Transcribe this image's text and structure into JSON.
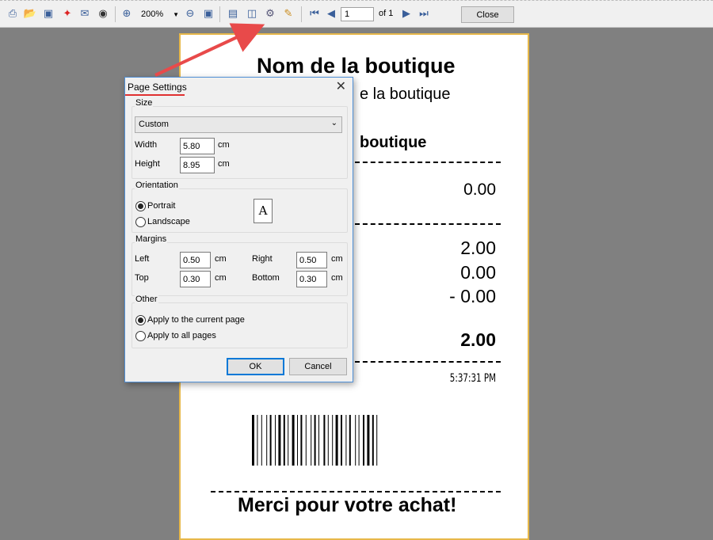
{
  "toolbar": {
    "icons": [
      "printer-icon",
      "open-folder-icon",
      "save-icon",
      "pdf-icon",
      "email-icon",
      "find-icon",
      "zoom-in-icon",
      "zoom-out-icon",
      "full-page-icon",
      "single-page-icon",
      "two-page-icon",
      "page-settings-icon",
      "edit-icon",
      "first-page-icon",
      "previous-page-icon",
      "next-page-icon",
      "last-page-icon"
    ],
    "zoom_value": "200%",
    "page_number": "1",
    "page_of": "of 1",
    "close_label": "Close"
  },
  "receipt": {
    "shop_name": "Nom de la boutique",
    "line2_partial": "e la boutique",
    "line3_partial": "boutique",
    "value1": "0.00",
    "value2": "2.00",
    "value3": "0.00",
    "value4": "- 0.00",
    "total": "2.00",
    "time": "5:37:31 PM",
    "thank_you": "Merci pour votre achat!"
  },
  "dialog": {
    "title": "Page Settings",
    "size_group": "Size",
    "size_value": "Custom",
    "width_label": "Width",
    "width_value": "5.80",
    "height_label": "Height",
    "height_value": "8.95",
    "unit": "cm",
    "orientation_group": "Orientation",
    "portrait_label": "Portrait",
    "landscape_label": "Landscape",
    "doc_icon_letter": "A",
    "margins_group": "Margins",
    "left_label": "Left",
    "left_value": "0.50",
    "right_label": "Right",
    "right_value": "0.50",
    "top_label": "Top",
    "top_value": "0.30",
    "bottom_label": "Bottom",
    "bottom_value": "0.30",
    "other_group": "Other",
    "apply_current_label": "Apply to the current page",
    "apply_all_label": "Apply to all pages",
    "ok_label": "OK",
    "cancel_label": "Cancel"
  },
  "colors": {
    "arrow": "#e84a4a",
    "title_underline": "#e03030",
    "dialog_border": "#4f8fd6",
    "receipt_border": "#e7b84a"
  }
}
